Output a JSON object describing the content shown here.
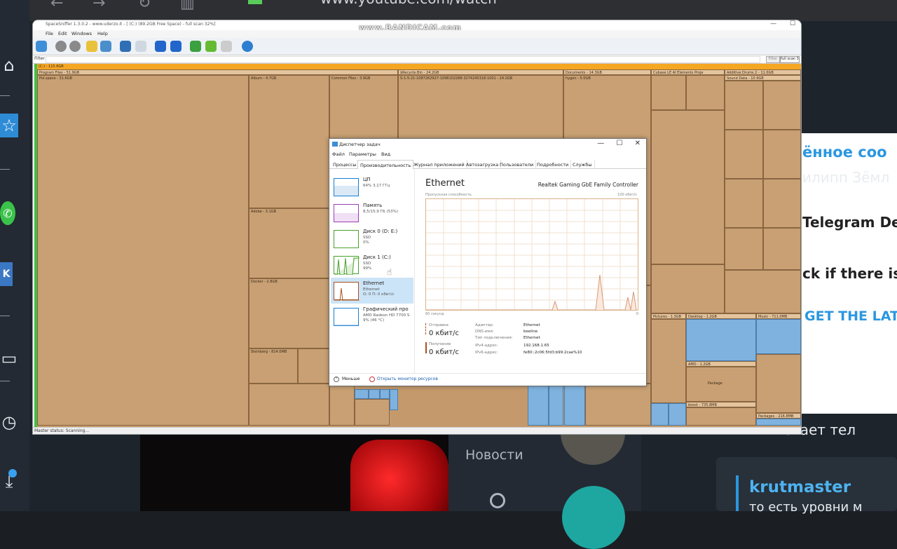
{
  "browser": {
    "url": "www.youtube.com/watch"
  },
  "sidebar": {
    "icons": [
      "home-icon",
      "star-icon",
      "whatsapp-icon",
      "vk-icon",
      "monitor-icon",
      "clock-icon",
      "download-icon"
    ]
  },
  "background_page": {
    "line1": "ённое соо",
    "line2": "илипп Зёмл",
    "line3": "Telegram Des",
    "line4": "ck if there is a",
    "line5": "GET THE LATE",
    "line6": "... вылетает тел",
    "news_label": "Новости",
    "username": "krutmaster",
    "user_text": "то есть уровни м"
  },
  "spacesniffer": {
    "title": "SpaceSniffer 1.3.0.2 - www.uderzo.it - [ (C:) (89.2GB Free Space) - full scan 32%]",
    "watermark": "www.BANDICAM.com",
    "menu": [
      "File",
      "Edit",
      "Windows",
      "Help"
    ],
    "filter_label": "Filter",
    "filter_button": "Filter",
    "scan_badge": "full scan 3",
    "status": "Master status: Scanning...",
    "root_label": "(C:) - 115.6GB",
    "blocks": [
      {
        "label": "Program Files - 51.9GB"
      },
      {
        "label": "Pol.space - 31.6GB"
      },
      {
        "label": "Album - 4.7GB"
      },
      {
        "label": "Common Files - 3.9GB"
      },
      {
        "label": "$Recycle.Bin - 24.2GB"
      },
      {
        "label": "S-1-5-21-1087262927-1098102288-3274245318-1001 - 24.2GB"
      },
      {
        "label": "Documents - 14.3GB"
      },
      {
        "label": "hygen - 5.0GB"
      },
      {
        "label": "Cubase LE AI Elements Proje"
      },
      {
        "label": "Additive Drums 2 - 11.0GB"
      },
      {
        "label": "Sound Data - 10.9GB"
      },
      {
        "label": "Adobe - 3.1GB"
      },
      {
        "label": "Docker - 2.8GB"
      },
      {
        "label": "Steinberg - 814.0MB"
      },
      {
        "label": "Pictures - 1.3GB"
      },
      {
        "label": "Desktop - 1.2GB"
      },
      {
        "label": "Music - 711.0MB"
      },
      {
        "label": "AMD - 1.2GB"
      },
      {
        "label": "Package"
      },
      {
        "label": "boost - 735.8MB"
      },
      {
        "label": "Packages - 216.8MB"
      }
    ]
  },
  "taskmanager": {
    "title": "Диспетчер задач",
    "menu": [
      "Файл",
      "Параметры",
      "Вид"
    ],
    "tabs": [
      "Процессы",
      "Производительность",
      "Журнал приложений",
      "Автозагрузка",
      "Пользователи",
      "Подробности",
      "Службы"
    ],
    "resources": [
      {
        "name": "ЦП",
        "sub": "64% 3,17 ГГц",
        "sub2": "",
        "color": "#1a7fd0"
      },
      {
        "name": "Память",
        "sub": "8,5/15,9 ГБ (53%)",
        "sub2": "",
        "color": "#9b3fb5"
      },
      {
        "name": "Диск 0 (D: E:)",
        "sub": "SSD",
        "sub2": "0%",
        "color": "#4aa02c"
      },
      {
        "name": "Диск 1 (C:)",
        "sub": "SSD",
        "sub2": "99%",
        "color": "#4aa02c"
      },
      {
        "name": "Ethernet",
        "sub": "Ethernet",
        "sub2": "О: 0 П: 0 кбит/с",
        "color": "#a7521f"
      },
      {
        "name": "Графический про",
        "sub": "AMD Radeon HD 7700 S",
        "sub2": "9% (46 °C)",
        "color": "#1a7fd0"
      }
    ],
    "detail": {
      "title": "Ethernet",
      "adapter": "Realtek Gaming GbE Family Controller",
      "capacity_label": "Пропускная способность",
      "max_label": "100 кбит/с",
      "time_label": "60 секунд",
      "zero_label": "0",
      "send_label": "Отправка",
      "send_value": "0 кбит/с",
      "recv_label": "Получение",
      "recv_value": "0 кбит/с",
      "props": [
        {
          "k": "Адаптер:",
          "v": "Ethernet"
        },
        {
          "k": "DNS-имя:",
          "v": "beeline"
        },
        {
          "k": "Тип подключения:",
          "v": "Ethernet"
        },
        {
          "k": "IPv4-адрес:",
          "v": "192.168.1.65"
        },
        {
          "k": "IPv6-адрес:",
          "v": "fe80::2c06:5fd3:b99:2cae%10"
        }
      ]
    },
    "footer": {
      "less": "Меньше",
      "monitor": "Открыть монитор ресурсов"
    }
  }
}
